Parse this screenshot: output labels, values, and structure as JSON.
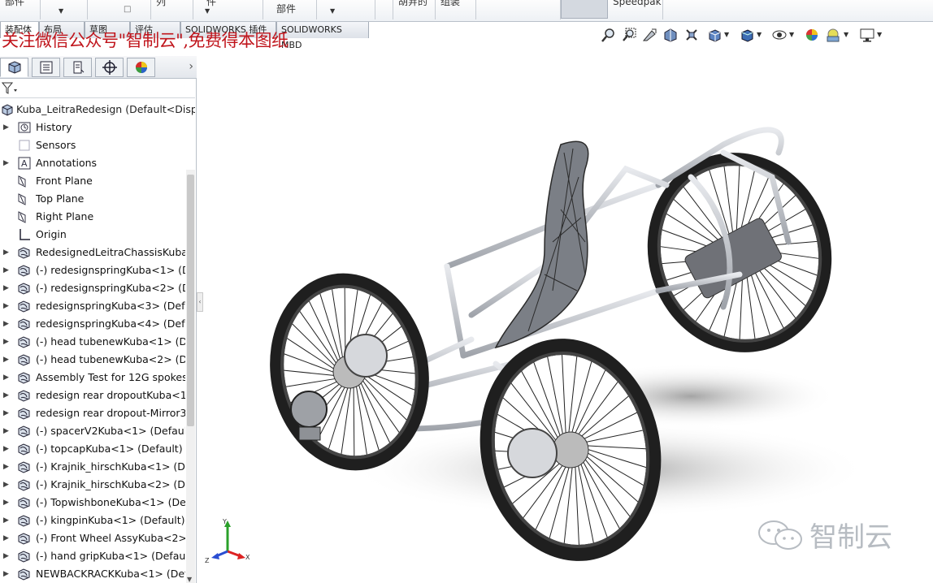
{
  "ribbon": {
    "fragments": [
      "部件",
      "",
      "列",
      "件",
      "部件",
      "",
      "胡笄的",
      "组装",
      "",
      "",
      "Speedpak"
    ]
  },
  "command_tabs": [
    "装配体",
    "布局",
    "草图",
    "评估",
    "SOLIDWORKS 插件",
    "SOLIDWORKS MBD"
  ],
  "banner": "关注微信公众号\"智制云\",免费得本图纸",
  "panel_tabs": [
    "feature-manager",
    "property-manager",
    "configuration-manager",
    "dimxpert-manager",
    "display-manager"
  ],
  "tree": {
    "root": "Kuba_LeitraRedesign  (Default<Disp",
    "items": [
      {
        "label": "History",
        "icon": "history-icon",
        "expand": true
      },
      {
        "label": "Sensors",
        "icon": "sensors-icon",
        "expand": false
      },
      {
        "label": "Annotations",
        "icon": "annotations-icon",
        "expand": true
      },
      {
        "label": "Front Plane",
        "icon": "plane-icon",
        "expand": false
      },
      {
        "label": "Top Plane",
        "icon": "plane-icon",
        "expand": false
      },
      {
        "label": "Right Plane",
        "icon": "plane-icon",
        "expand": false
      },
      {
        "label": "Origin",
        "icon": "origin-icon",
        "expand": false
      },
      {
        "label": "RedesignedLeitraChassisKuba<",
        "icon": "part-icon",
        "expand": true
      },
      {
        "label": "(-) redesignspringKuba<1> (De",
        "icon": "part-icon",
        "expand": true
      },
      {
        "label": "(-) redesignspringKuba<2> (De",
        "icon": "part-icon",
        "expand": true
      },
      {
        "label": "redesignspringKuba<3> (Defau",
        "icon": "part-icon",
        "expand": true
      },
      {
        "label": "redesignspringKuba<4> (Defau",
        "icon": "part-icon",
        "expand": true
      },
      {
        "label": "(-) head tubenewKuba<1> (Def",
        "icon": "part-icon",
        "expand": true
      },
      {
        "label": "(-) head tubenewKuba<2> (Def",
        "icon": "part-icon",
        "expand": true
      },
      {
        "label": "Assembly Test for 12G spokesk",
        "icon": "part-icon",
        "expand": true
      },
      {
        "label": "redesign rear dropoutKuba<1>",
        "icon": "part-icon",
        "expand": true
      },
      {
        "label": "redesign rear dropout-Mirror3",
        "icon": "part-icon",
        "expand": true
      },
      {
        "label": "(-) spacerV2Kuba<1> (Default<",
        "icon": "part-icon",
        "expand": true
      },
      {
        "label": "(-) topcapKuba<1> (Default)",
        "icon": "part-icon",
        "expand": true
      },
      {
        "label": "(-) Krajnik_hirschKuba<1> (Defa",
        "icon": "part-icon",
        "expand": true
      },
      {
        "label": "(-) Krajnik_hirschKuba<2> (Defa",
        "icon": "part-icon",
        "expand": true
      },
      {
        "label": "(-) TopwishboneKuba<1> (Defa",
        "icon": "part-icon",
        "expand": true
      },
      {
        "label": "(-) kingpinKuba<1> (Default)",
        "icon": "part-icon",
        "expand": true
      },
      {
        "label": "(-) Front Wheel AssyKuba<2> (",
        "icon": "part-icon",
        "expand": true
      },
      {
        "label": "(-) hand gripKuba<1> (Default)",
        "icon": "part-icon",
        "expand": true
      },
      {
        "label": "NEWBACKRACKKuba<1> (Defa",
        "icon": "part-icon",
        "expand": true
      }
    ]
  },
  "triad": {
    "x": "X",
    "y": "Y",
    "z": "Z"
  },
  "watermark": {
    "text": "智制云"
  },
  "colors": {
    "banner": "#c0141b",
    "tire": "#262626",
    "frame": "#c9ccd2",
    "panel_border": "#b9c0c9"
  }
}
